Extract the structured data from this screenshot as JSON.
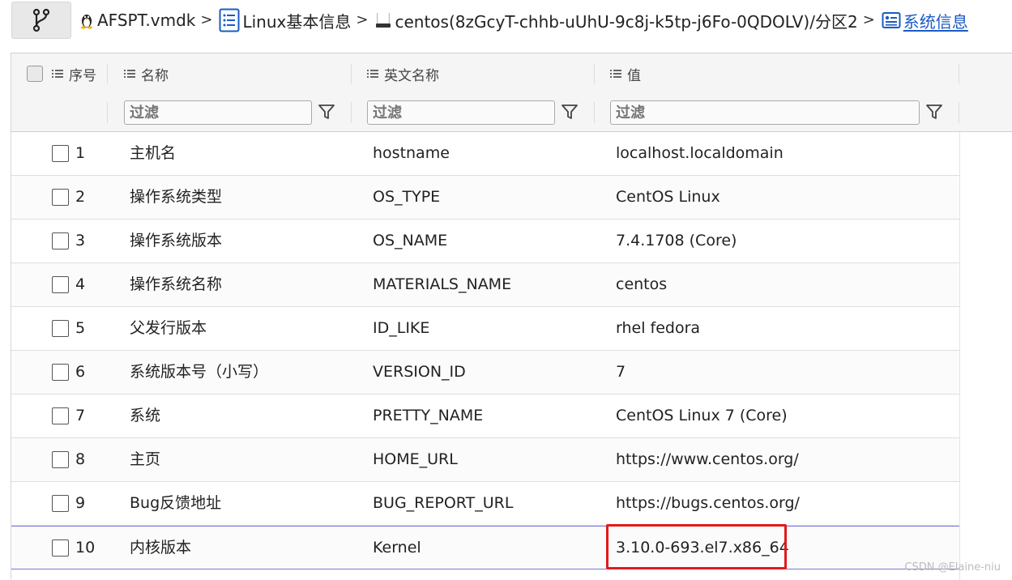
{
  "breadcrumb": {
    "items": [
      {
        "label": "AFSPT.vmdk",
        "icon": "linux-penguin-icon"
      },
      {
        "label": "Linux基本信息",
        "icon": "list-icon"
      },
      {
        "label": "centos(8zGcyT-chhb-uUhU-9c8j-k5tp-j6Fo-0QDOLV)/分区2",
        "icon": "disk-icon"
      },
      {
        "label": "系统信息",
        "icon": "system-info-icon"
      }
    ],
    "separator": ">"
  },
  "table": {
    "columns": [
      "序号",
      "名称",
      "英文名称",
      "值"
    ],
    "filter_placeholder": "过滤",
    "rows": [
      {
        "index": "1",
        "name": "主机名",
        "en": "hostname",
        "value": "localhost.localdomain"
      },
      {
        "index": "2",
        "name": "操作系统类型",
        "en": "OS_TYPE",
        "value": "CentOS Linux"
      },
      {
        "index": "3",
        "name": "操作系统版本",
        "en": "OS_NAME",
        "value": "7.4.1708 (Core)"
      },
      {
        "index": "4",
        "name": "操作系统名称",
        "en": "MATERIALS_NAME",
        "value": "centos"
      },
      {
        "index": "5",
        "name": "父发行版本",
        "en": "ID_LIKE",
        "value": "rhel fedora"
      },
      {
        "index": "6",
        "name": "系统版本号（小写）",
        "en": "VERSION_ID",
        "value": "7"
      },
      {
        "index": "7",
        "name": "系统",
        "en": "PRETTY_NAME",
        "value": "CentOS Linux 7 (Core)"
      },
      {
        "index": "8",
        "name": "主页",
        "en": "HOME_URL",
        "value": "https://www.centos.org/"
      },
      {
        "index": "9",
        "name": "Bug反馈地址",
        "en": "BUG_REPORT_URL",
        "value": "https://bugs.centos.org/"
      },
      {
        "index": "10",
        "name": "内核版本",
        "en": "Kernel",
        "value": "3.10.0-693.el7.x86_64"
      }
    ]
  },
  "watermark": "CSDN @Elaine-niu",
  "colors": {
    "active_link": "#1a5bc4",
    "highlight": "#e01b1b",
    "selected_row_border": "#7a78d6"
  }
}
